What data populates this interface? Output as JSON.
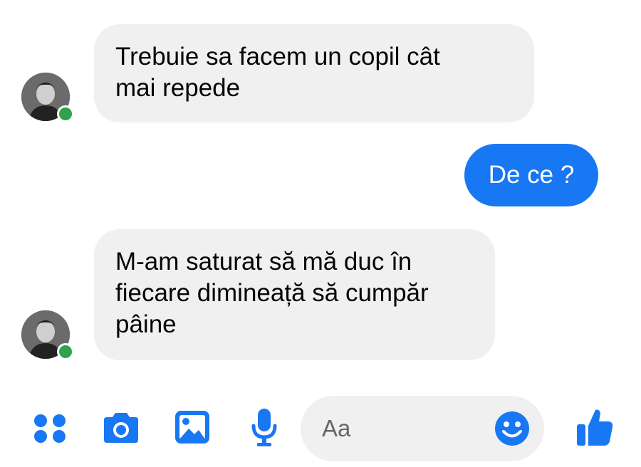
{
  "conversation": {
    "messages": [
      {
        "direction": "incoming",
        "lines": [
          "Trebuie sa facem un copil cât",
          "mai repede"
        ]
      },
      {
        "direction": "outgoing",
        "lines": [
          "De ce ?"
        ]
      },
      {
        "direction": "incoming",
        "lines": [
          "M-am saturat să mă duc în",
          "fiecare dimineață să cumpăr",
          "pâine"
        ]
      }
    ]
  },
  "composer": {
    "placeholder": "Aa",
    "icons": [
      "apps-icon",
      "camera-icon",
      "image-icon",
      "microphone-icon",
      "emoji-icon",
      "thumbs-up-icon"
    ]
  },
  "colors": {
    "accent": "#1877f2",
    "incoming_bubble": "#f0f0f0",
    "online_dot": "#31a24c"
  }
}
